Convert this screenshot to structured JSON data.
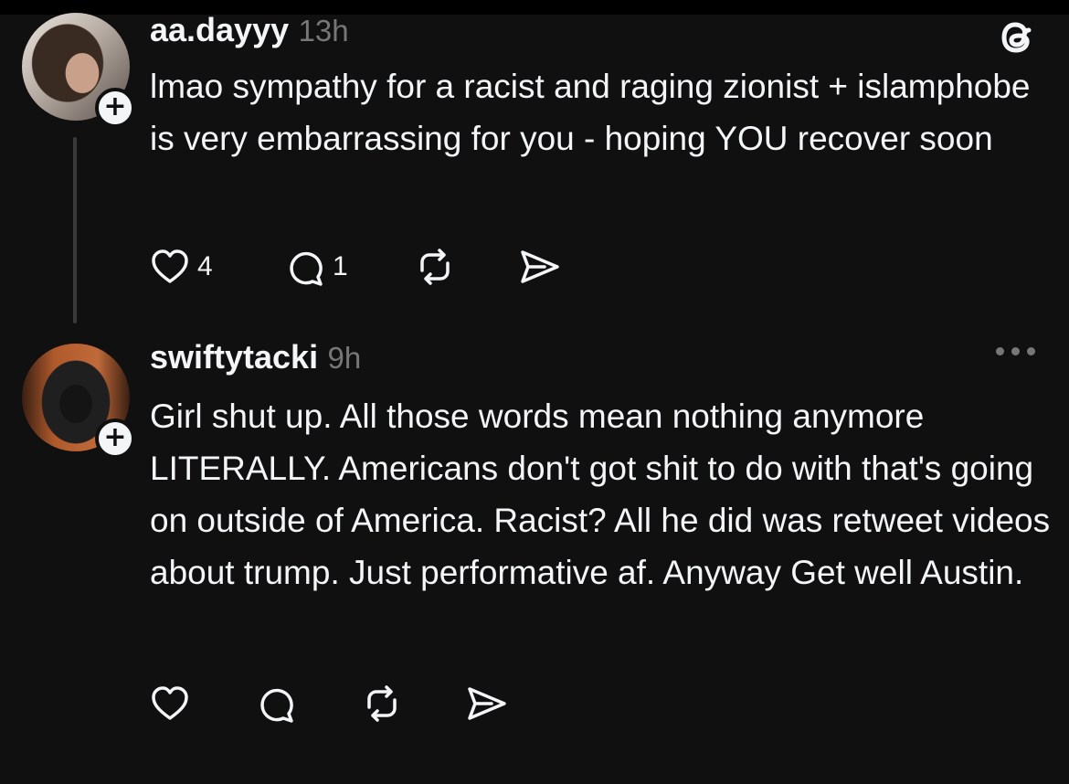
{
  "posts": [
    {
      "username": "aa.dayyy",
      "timestamp": "13h",
      "text": "lmao sympathy for a racist and raging zionist + islamphobe is very embarrassing for you - hoping YOU recover soon",
      "likes": "4",
      "replies": "1",
      "corner_icon": "threads-logo-icon"
    },
    {
      "username": "swiftytacki",
      "timestamp": "9h",
      "text": "Girl shut up. All those words mean nothing anymore LITERALLY. Americans don't got shit to do with that's going on outside of America. Racist? All he did was retweet videos about trump. Just performative af. Anyway Get well Austin.",
      "likes": "",
      "replies": "",
      "corner_icon": "more-options-icon"
    }
  ],
  "follow_badge": "+",
  "icons": [
    "heart-icon",
    "comment-icon",
    "repost-icon",
    "share-icon"
  ],
  "colors": {
    "background": "#101010",
    "text": "#f3f5f7",
    "muted": "#777777"
  }
}
